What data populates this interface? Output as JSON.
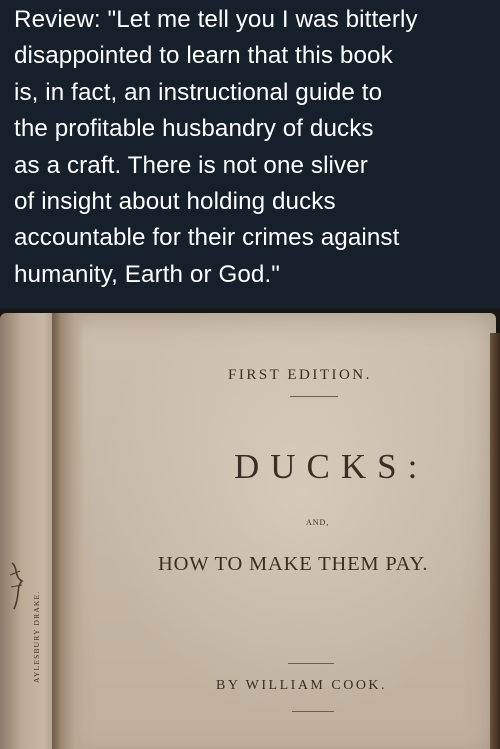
{
  "post": {
    "text": "Review: \"Let me tell you I was bitterly\ndisappointed to learn that this book\nis, in fact, an instructional guide to\nthe profitable husbandry of ducks\nas a craft. There is not one sliver\nof insight about holding ducks\naccountable for their crimes against\nhumanity, Earth or God.\""
  },
  "book_page": {
    "edition": "FIRST EDITION.",
    "title": "DUCKS:",
    "conjunction": "AND,",
    "subtitle": "HOW TO MAKE THEM PAY.",
    "author": "BY WILLIAM COOK.",
    "plate_caption": "AYLESBURY DRAKE."
  }
}
